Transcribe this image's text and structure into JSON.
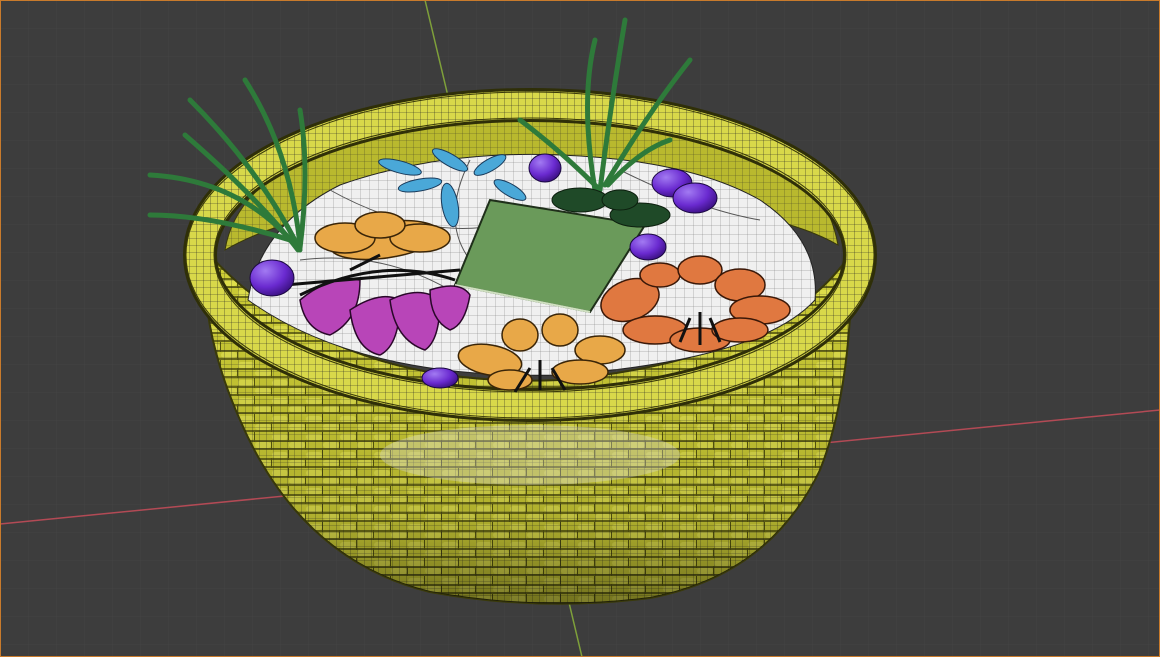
{
  "viewport": {
    "kind": "3D viewport",
    "background": "#3d3d3d",
    "grid_color": "#444444",
    "frame_color": "#c97b2c"
  },
  "axes": {
    "x_axis_color": "#b34a55",
    "y_axis_color": "#7ea03a"
  },
  "scene": {
    "shading": "wireframe-overlay",
    "objects": [
      {
        "name": "basket",
        "color": "#d2d23c"
      },
      {
        "name": "basket-rim",
        "color": "#d8d84a"
      },
      {
        "name": "cloth-liner",
        "color": "#f0f0f0"
      },
      {
        "name": "green-card",
        "color": "#6a9a5a"
      },
      {
        "name": "orange-flower",
        "color": "#e07840"
      },
      {
        "name": "yellow-flower",
        "color": "#e8a848"
      },
      {
        "name": "purple-flower",
        "color": "#b845b8"
      },
      {
        "name": "blue-leaves",
        "color": "#4aa8d8"
      },
      {
        "name": "purple-berries",
        "color": "#7a3ad6"
      },
      {
        "name": "green-sprigs",
        "color": "#2e7a3a"
      }
    ]
  }
}
